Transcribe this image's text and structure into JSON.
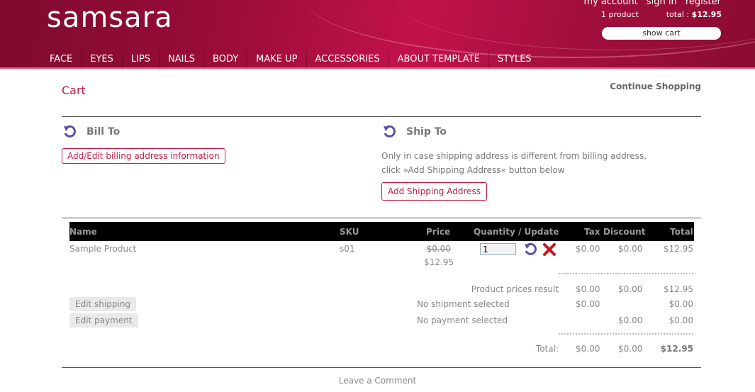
{
  "header": {
    "logo": "samsara",
    "account_links": [
      "my account",
      "sign in",
      "register"
    ],
    "product_count": "1 product",
    "total_label": "total :",
    "total_value": "$12.95",
    "show_cart": "show cart",
    "nav": [
      "FACE",
      "EYES",
      "LIPS",
      "NAILS",
      "BODY",
      "MAKE UP",
      "ACCESSORIES",
      "ABOUT TEMPLATE",
      "STYLES"
    ],
    "brand_color": "#9a0d38"
  },
  "page": {
    "title": "Cart",
    "continue_shopping": "Continue Shopping",
    "accent_color": "#c21a45"
  },
  "bill_to": {
    "heading": "Bill To",
    "button": "Add/Edit billing address information"
  },
  "ship_to": {
    "heading": "Ship To",
    "note_line1": "Only in case shipping address is different from billing address,",
    "note_line2": "click »Add Shipping Address« button below",
    "button": "Add Shipping Address"
  },
  "table": {
    "headers": {
      "name": "Name",
      "sku": "SKU",
      "price": "Price",
      "qty": "Quantity / Update",
      "tax": "Tax",
      "discount": "Discount",
      "total": "Total"
    },
    "rows": [
      {
        "name": "Sample Product",
        "sku": "s01",
        "old_price": "$0.00",
        "price": "$12.95",
        "quantity": "1",
        "tax": "$0.00",
        "discount": "$0.00",
        "total": "$12.95"
      }
    ],
    "product_prices": {
      "label": "Product prices result",
      "tax": "$0.00",
      "discount": "$0.00",
      "total": "$12.95"
    },
    "shipping": {
      "button": "Edit shipping",
      "label": "No shipment selected",
      "tax": "$0.00",
      "total": "$0.00"
    },
    "payment": {
      "button": "Edit payment",
      "label": "No payment selected",
      "discount": "$0.00",
      "total": "$0.00"
    },
    "grand": {
      "label": "Total:",
      "tax": "$0.00",
      "discount": "$0.00",
      "total": "$12.95"
    }
  },
  "footer": {
    "comment_link": "Leave a Comment"
  },
  "icons": {
    "update": "refresh-icon",
    "delete": "delete-x-icon"
  }
}
